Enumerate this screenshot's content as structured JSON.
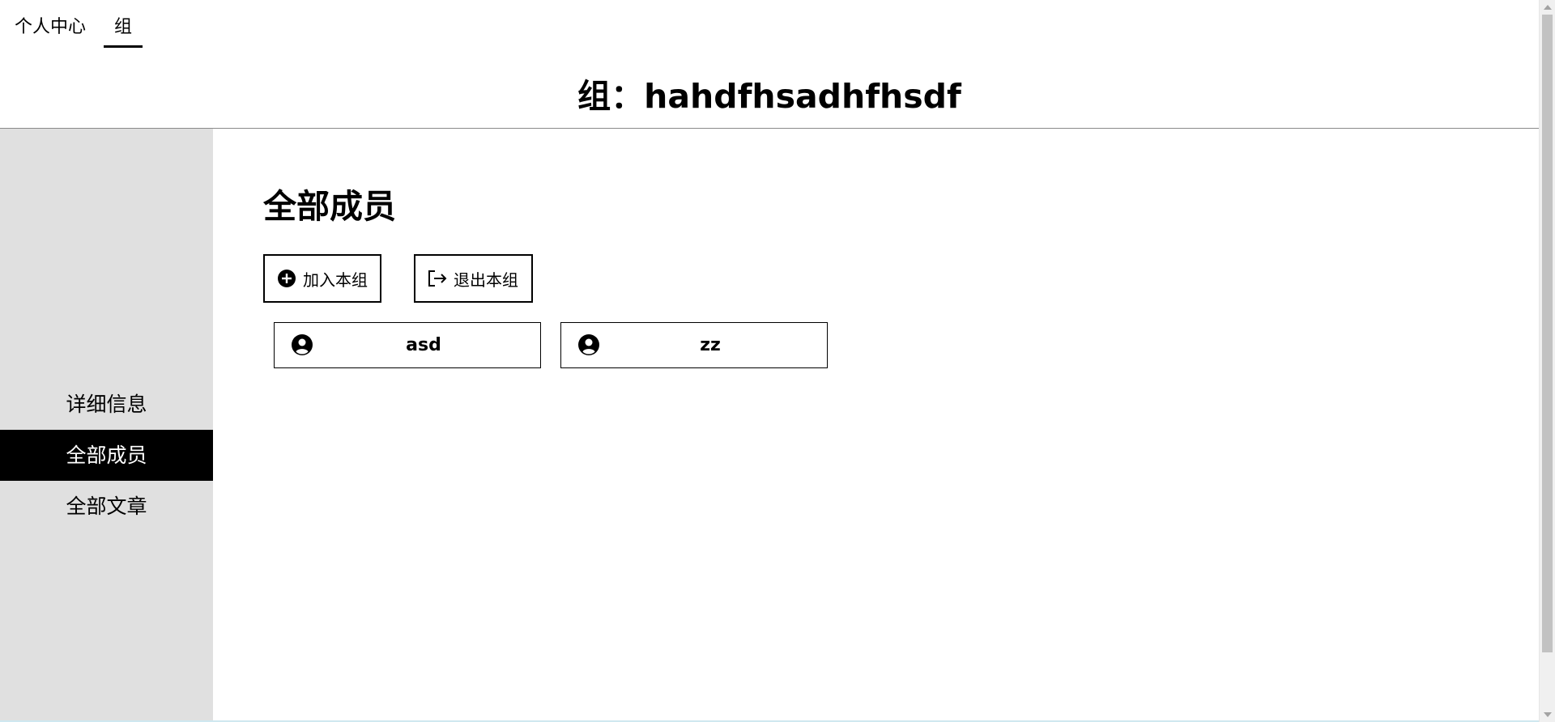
{
  "topnav": {
    "items": [
      {
        "label": "个人中心"
      },
      {
        "label": "组"
      }
    ]
  },
  "header": {
    "title": "组：hahdfhsadhfhsdf"
  },
  "sidebar": {
    "items": [
      {
        "label": "详细信息"
      },
      {
        "label": "全部成员"
      },
      {
        "label": "全部文章"
      }
    ],
    "active_index": 1
  },
  "main": {
    "section_title": "全部成员",
    "join_button": {
      "label": "加入本组",
      "icon": "plus-circle-icon"
    },
    "leave_button": {
      "label": "退出本组",
      "icon": "logout-icon"
    },
    "members": [
      {
        "name": "asd",
        "icon": "user-circle-icon"
      },
      {
        "name": "zz",
        "icon": "user-circle-icon"
      }
    ]
  }
}
